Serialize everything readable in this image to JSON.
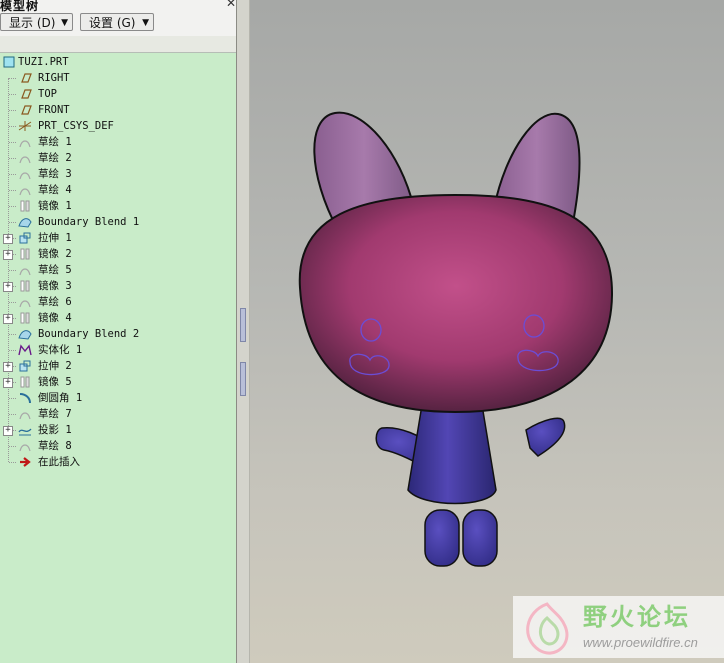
{
  "panel": {
    "title": "模型树",
    "display_button": "显示 (D)",
    "settings_button": "设置 (G)",
    "close_glyph": "✕"
  },
  "tree": [
    {
      "label": "TUZI.PRT",
      "icon": "part-icon",
      "expander": false
    },
    {
      "label": "RIGHT",
      "icon": "datum-plane-icon",
      "expander": false
    },
    {
      "label": "TOP",
      "icon": "datum-plane-icon",
      "expander": false
    },
    {
      "label": "FRONT",
      "icon": "datum-plane-icon",
      "expander": false
    },
    {
      "label": "PRT_CSYS_DEF",
      "icon": "coordinate-system-icon",
      "expander": false
    },
    {
      "label": "草绘 1",
      "icon": "sketch-icon",
      "expander": false
    },
    {
      "label": "草绘 2",
      "icon": "sketch-icon",
      "expander": false
    },
    {
      "label": "草绘 3",
      "icon": "sketch-icon",
      "expander": false
    },
    {
      "label": "草绘 4",
      "icon": "sketch-icon",
      "expander": false
    },
    {
      "label": "镜像 1",
      "icon": "mirror-icon",
      "expander": false
    },
    {
      "label": "Boundary Blend 1",
      "icon": "boundary-blend-icon",
      "expander": false
    },
    {
      "label": "拉伸 1",
      "icon": "extrude-icon",
      "expander": true
    },
    {
      "label": "镜像 2",
      "icon": "mirror-icon",
      "expander": true
    },
    {
      "label": "草绘 5",
      "icon": "sketch-icon",
      "expander": false
    },
    {
      "label": "镜像 3",
      "icon": "mirror-icon",
      "expander": true
    },
    {
      "label": "草绘 6",
      "icon": "sketch-icon",
      "expander": false
    },
    {
      "label": "镜像 4",
      "icon": "mirror-icon",
      "expander": true
    },
    {
      "label": "Boundary Blend 2",
      "icon": "boundary-blend-icon",
      "expander": false
    },
    {
      "label": "实体化 1",
      "icon": "solidify-icon",
      "expander": false
    },
    {
      "label": "拉伸 2",
      "icon": "extrude-icon",
      "expander": true
    },
    {
      "label": "镜像 5",
      "icon": "mirror-icon",
      "expander": true
    },
    {
      "label": "倒圆角 1",
      "icon": "round-icon",
      "expander": false
    },
    {
      "label": "草绘 7",
      "icon": "sketch-icon",
      "expander": false
    },
    {
      "label": "投影 1",
      "icon": "projection-icon",
      "expander": true
    },
    {
      "label": "草绘 8",
      "icon": "sketch-icon",
      "expander": false
    },
    {
      "label": "在此插入",
      "icon": "insert-here-arrow-icon",
      "expander": false
    }
  ],
  "viewport": {
    "model": "rabbit-3d-model",
    "colors": {
      "head": "#b8457c",
      "ears": "#9a6a9c",
      "body": "#4a3fa0",
      "accent": "#6a4fd0"
    }
  },
  "watermark": {
    "title": "野火论坛",
    "url": "www.proewildfire.cn"
  }
}
